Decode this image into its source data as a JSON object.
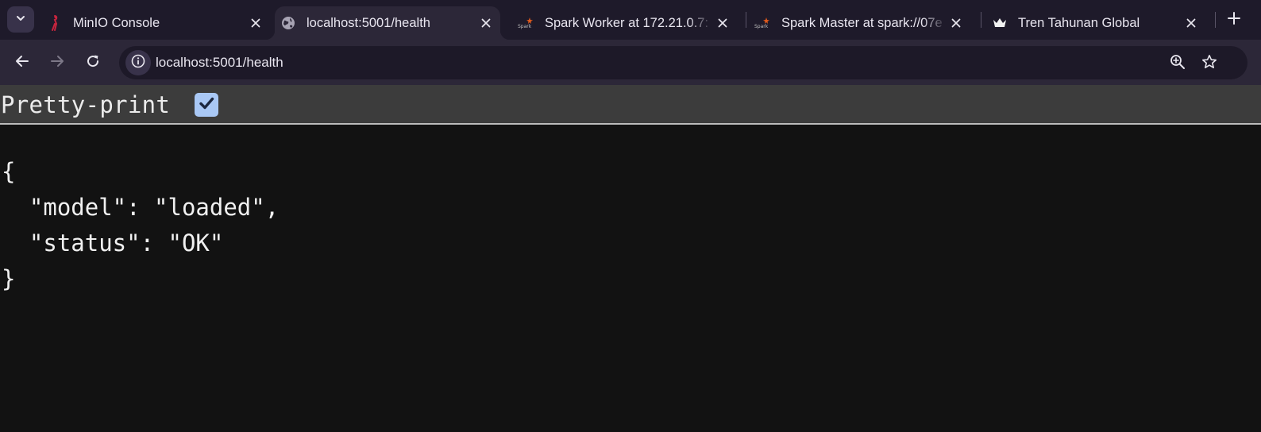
{
  "browser": {
    "tabs": [
      {
        "title": "MinIO Console",
        "favicon": "minio-flamingo-icon"
      },
      {
        "title": "localhost:5001/health",
        "favicon": "globe-icon"
      },
      {
        "title": "Spark Worker at 172.21.0.7:",
        "favicon": "spark-logo-icon"
      },
      {
        "title": "Spark Master at spark://07e",
        "favicon": "spark-logo-icon"
      },
      {
        "title": "Tren Tahunan Global",
        "favicon": "crown-icon"
      }
    ],
    "active_tab_index": 1,
    "address_bar": {
      "url": "localhost:5001/health"
    }
  },
  "viewer": {
    "pretty_print_label": "Pretty-print",
    "pretty_print_checked": true,
    "json": {
      "open_brace": "{",
      "line_model": "  \"model\": \"loaded\",",
      "line_status": "  \"status\": \"OK\"",
      "close_brace": "}"
    }
  },
  "colors": {
    "tabstrip_bg": "#1e1a2a",
    "active_tab_bg": "#2c2738",
    "page_bg": "#121212",
    "pretty_bar_bg": "#3c3c3c",
    "checkbox_accent": "#a9c8f5"
  }
}
